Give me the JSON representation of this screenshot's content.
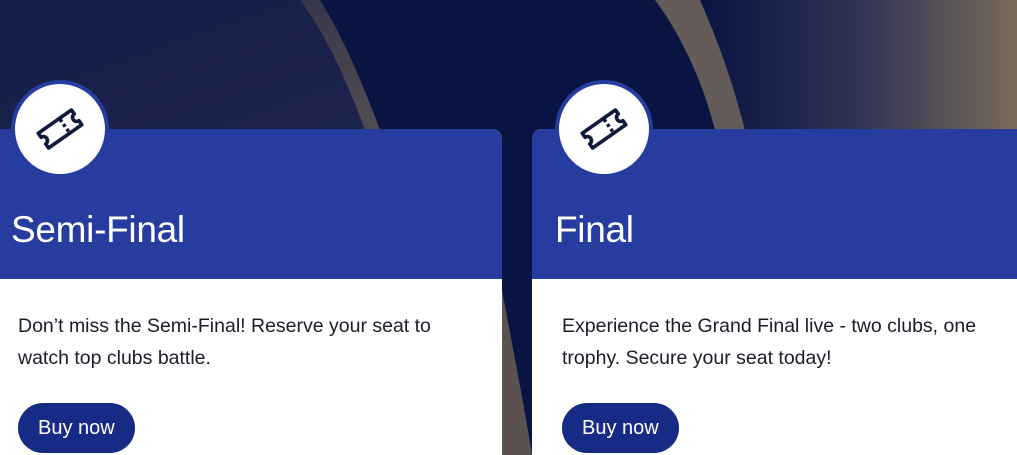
{
  "colors": {
    "background": "#0a1442",
    "header": "#263d9f",
    "button": "#172a86",
    "card": "#ffffff",
    "text": "#1c1c2a"
  },
  "cards": [
    {
      "icon": "ticket-icon",
      "title": "Semi-Final",
      "description": "Don’t miss the Semi-Final! Reserve your seat to watch top clubs battle.",
      "button_label": "Buy now"
    },
    {
      "icon": "ticket-icon",
      "title": "Final",
      "description": "Experience the Grand Final live - two clubs, one trophy. Secure your seat today!",
      "button_label": "Buy now"
    }
  ]
}
